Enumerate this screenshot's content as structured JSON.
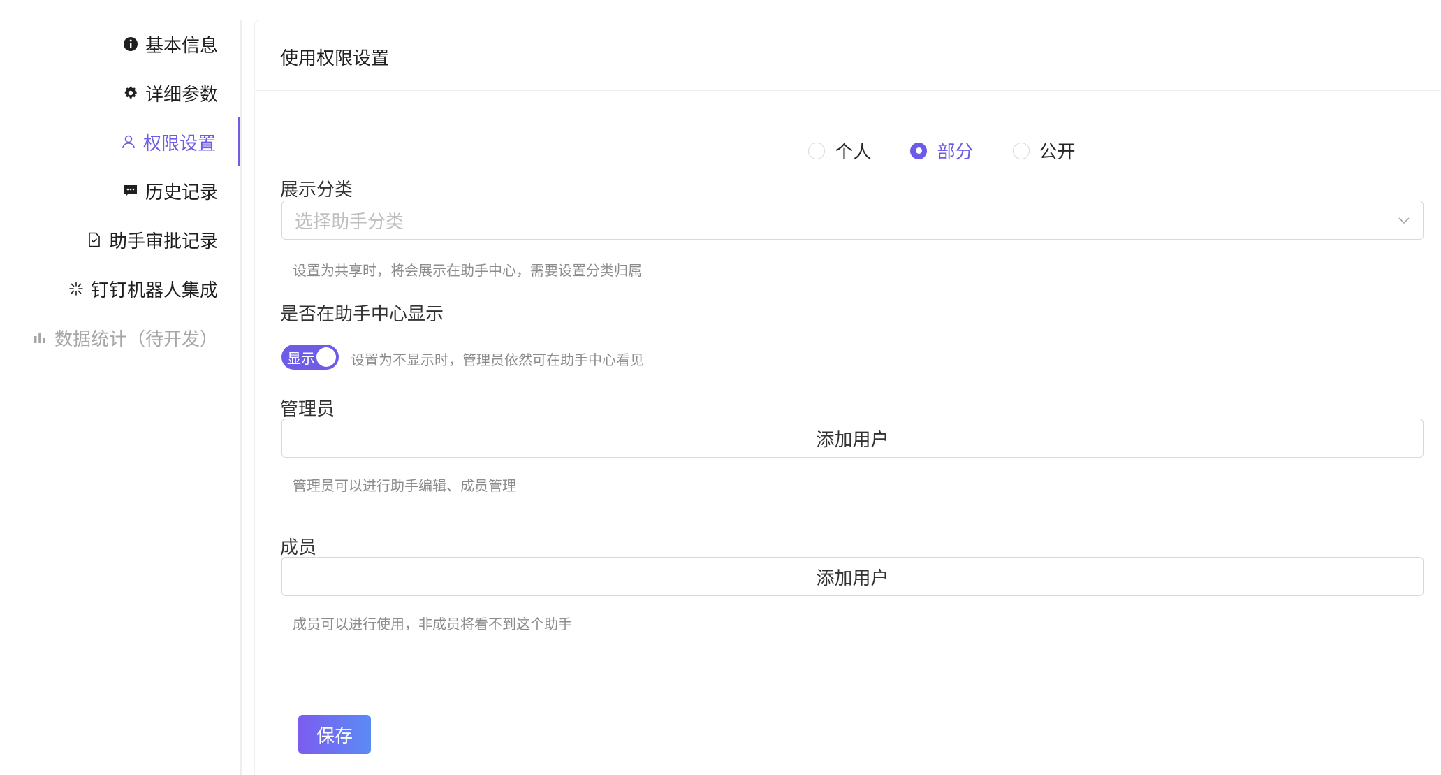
{
  "sidebar": {
    "items": [
      {
        "label": "基本信息",
        "icon": "info-icon",
        "state": "normal"
      },
      {
        "label": "详细参数",
        "icon": "gear-icon",
        "state": "normal"
      },
      {
        "label": "权限设置",
        "icon": "user-icon",
        "state": "active"
      },
      {
        "label": "历史记录",
        "icon": "message-icon",
        "state": "normal"
      },
      {
        "label": "助手审批记录",
        "icon": "file-check-icon",
        "state": "normal"
      },
      {
        "label": "钉钉机器人集成",
        "icon": "sparkle-icon",
        "state": "normal"
      },
      {
        "label": "数据统计（待开发）",
        "icon": "bar-chart-icon",
        "state": "disabled"
      }
    ]
  },
  "main": {
    "title": "使用权限设置",
    "visibility": {
      "options": [
        "个人",
        "部分",
        "公开"
      ],
      "selected": "部分"
    },
    "category": {
      "label": "展示分类",
      "placeholder": "选择助手分类",
      "help": "设置为共享时，将会展示在助手中心，需要设置分类归属"
    },
    "show_in_center": {
      "label": "是否在助手中心显示",
      "switch_text": "显示",
      "checked": true,
      "help": "设置为不显示时，管理员依然可在助手中心看见"
    },
    "admins": {
      "label": "管理员",
      "add_label": "添加用户",
      "help": "管理员可以进行助手编辑、成员管理"
    },
    "members": {
      "label": "成员",
      "add_label": "添加用户",
      "help": "成员可以进行使用，非成员将看不到这个助手"
    },
    "save_label": "保存"
  },
  "colors": {
    "accent": "#6c5ce7",
    "text": "#262626",
    "muted": "#8c8c8c",
    "border": "#d9d9d9"
  }
}
